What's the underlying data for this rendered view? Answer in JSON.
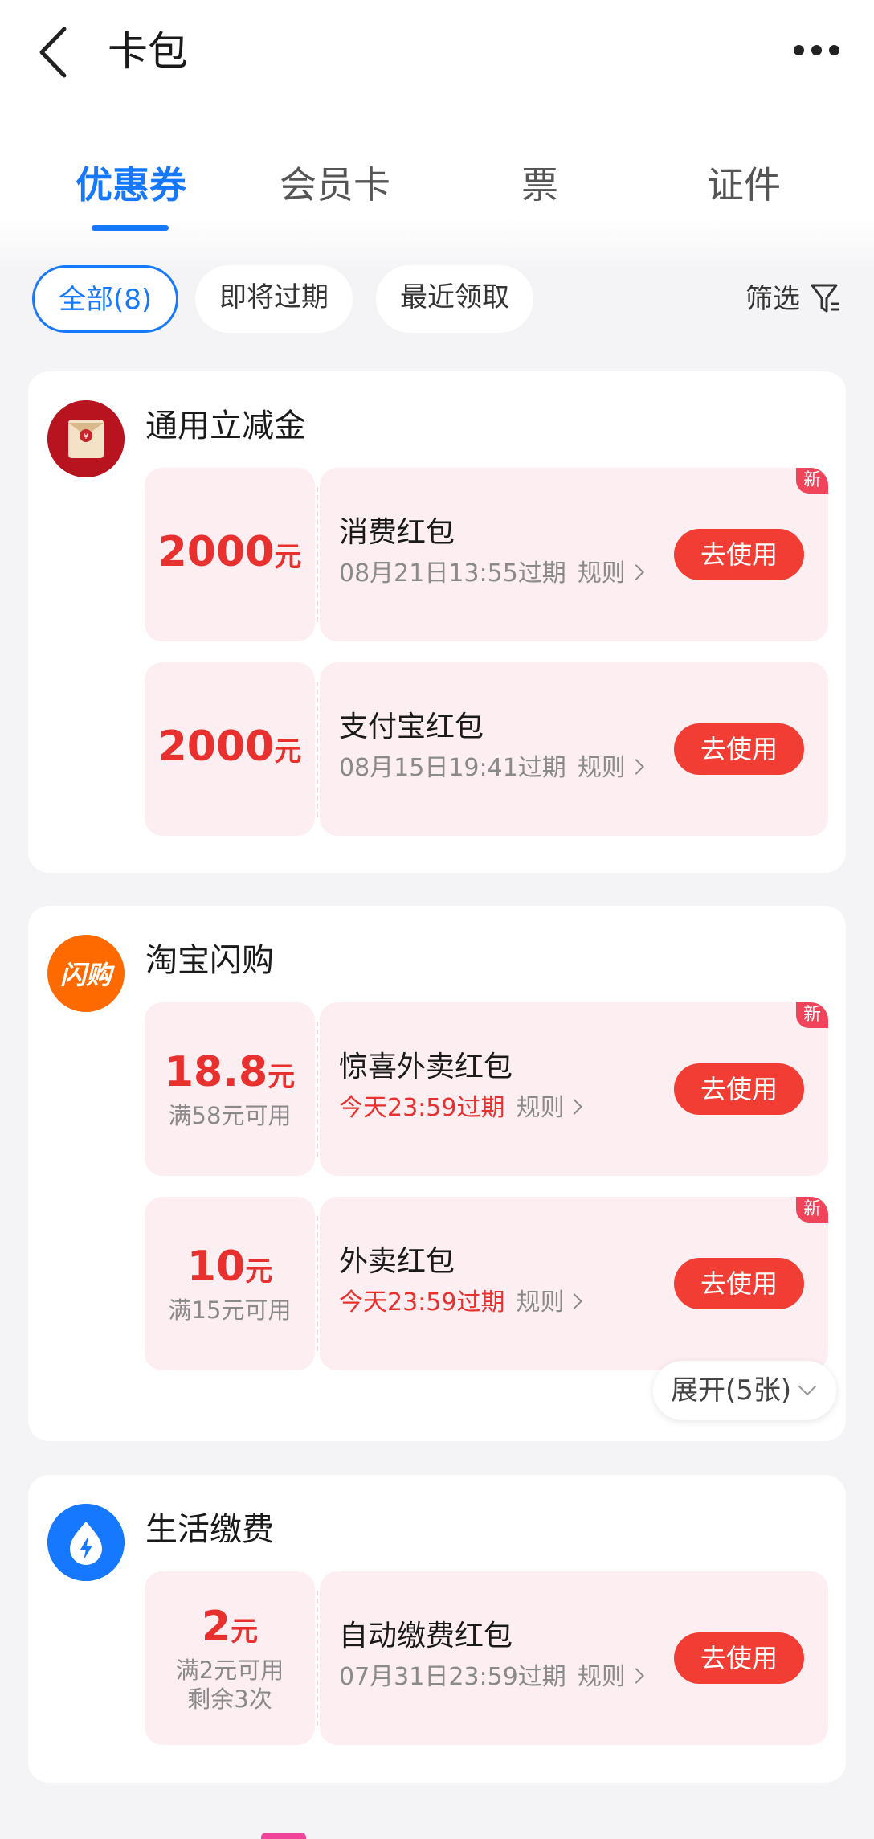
{
  "header": {
    "title": "卡包"
  },
  "tabs": [
    {
      "label": "优惠券",
      "active": true
    },
    {
      "label": "会员卡",
      "active": false
    },
    {
      "label": "票",
      "active": false
    },
    {
      "label": "证件",
      "active": false
    }
  ],
  "filters": {
    "chips": [
      "全部(8)",
      "即将过期",
      "最近领取"
    ],
    "filter_label": "筛选"
  },
  "colors": {
    "accent": "#1677ff",
    "red": "#e8312f",
    "button": "#f23d34",
    "coupon_bg": "#fdeff1"
  },
  "cards": [
    {
      "title": "通用立减金",
      "icon": "red-envelope-icon",
      "coupons": [
        {
          "amount": "2000",
          "unit": "元",
          "condition": "",
          "title": "消费红包",
          "expiry": "08月21日13:55过期",
          "rule": "规则",
          "button": "去使用",
          "badge": "新",
          "expiry_red": false
        },
        {
          "amount": "2000",
          "unit": "元",
          "condition": "",
          "title": "支付宝红包",
          "expiry": "08月15日19:41过期",
          "rule": "规则",
          "button": "去使用",
          "badge": "",
          "expiry_red": false
        }
      ]
    },
    {
      "title": "淘宝闪购",
      "icon_text": "闪购",
      "coupons": [
        {
          "amount": "18.8",
          "unit": "元",
          "condition": "满58元可用",
          "title": "惊喜外卖红包",
          "expiry": "今天23:59过期",
          "rule": "规则",
          "button": "去使用",
          "badge": "新",
          "expiry_red": true
        },
        {
          "amount": "10",
          "unit": "元",
          "condition": "满15元可用",
          "title": "外卖红包",
          "expiry": "今天23:59过期",
          "rule": "规则",
          "button": "去使用",
          "badge": "新",
          "expiry_red": true
        }
      ],
      "expand": "展开(5张)"
    },
    {
      "title": "生活缴费",
      "icon": "lightning-icon",
      "coupons": [
        {
          "amount": "2",
          "unit": "元",
          "condition": "满2元可用",
          "condition2": "剩余3次",
          "title": "自动缴费红包",
          "expiry": "07月31日23:59过期",
          "rule": "规则",
          "button": "去使用",
          "badge": "",
          "expiry_red": false
        }
      ]
    }
  ]
}
